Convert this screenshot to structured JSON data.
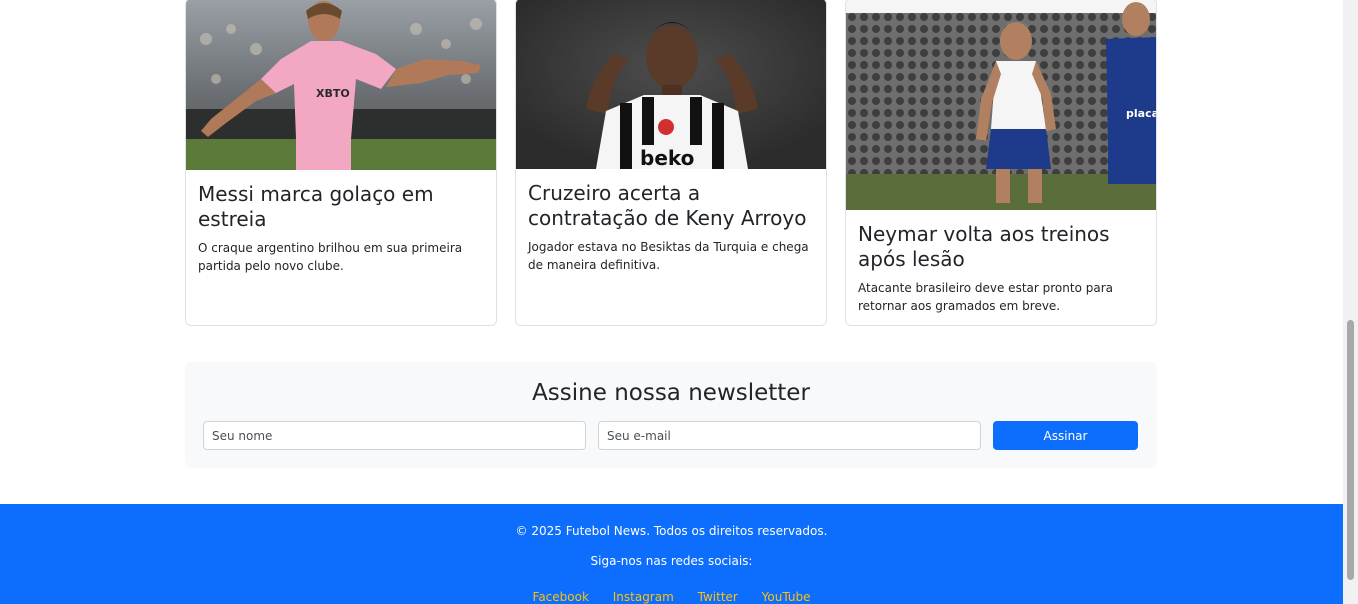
{
  "cards": [
    {
      "title": "Messi marca golaço em estreia",
      "text": "O craque argentino brilhou em sua primeira partida pelo novo clube."
    },
    {
      "title": "Cruzeiro acerta a contratação de Keny Arroyo",
      "text": "Jogador estava no Besiktas da Turquia e chega de maneira definitiva."
    },
    {
      "title": "Neymar volta aos treinos após lesão",
      "text": "Atacante brasileiro deve estar pronto para retornar aos gramados em breve."
    }
  ],
  "image_text": {
    "card1_shirt": "XBTO",
    "card2_shirt": "beko",
    "card3_sponsor": "placa"
  },
  "newsletter": {
    "title": "Assine nossa newsletter",
    "name_placeholder": "Seu nome",
    "email_placeholder": "Seu e-mail",
    "button_label": "Assinar"
  },
  "footer": {
    "copyright": "© 2025 Futebol News. Todos os direitos reservados.",
    "follow": "Siga-nos nas redes sociais:",
    "links": [
      "Facebook",
      "Instagram",
      "Twitter",
      "YouTube"
    ]
  },
  "colors": {
    "primary": "#0d6efd",
    "link": "#ffc107",
    "newsletter_bg": "#f8f9fa"
  }
}
